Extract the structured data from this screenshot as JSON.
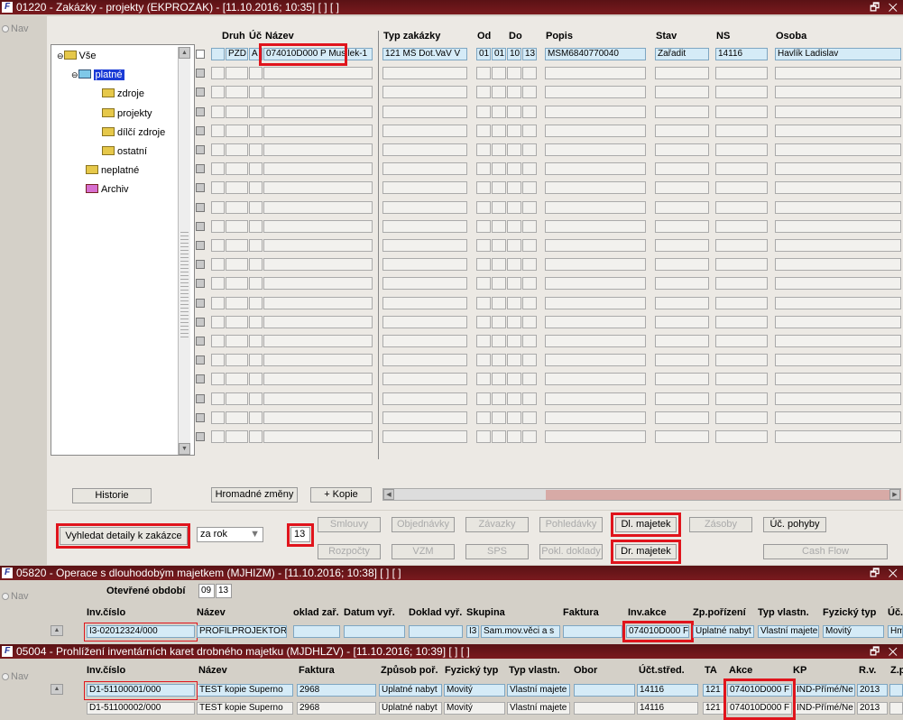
{
  "win1": {
    "title": "01220 - Zakázky - projekty (EKPROZAK) - [11.10.2016; 10:35]  [ ]  [ ]",
    "controls": "🗗 ✕"
  },
  "nav": "Nav",
  "tree": {
    "root": "Vše",
    "platne": "platné",
    "zdroje": "zdroje",
    "projekty": "projekty",
    "dilci": "dílčí zdroje",
    "ostatni": "ostatní",
    "neplatne": "neplatné",
    "archiv": "Archiv"
  },
  "grid": {
    "headers": {
      "druh": "Druh",
      "uc": "Úč",
      "nazev": "Název",
      "typ": "Typ zakázky",
      "od": "Od",
      "do": "Do",
      "popis": "Popis",
      "stav": "Stav",
      "ns": "NS",
      "osoba": "Osoba"
    },
    "row1": {
      "druh": "PZD",
      "uc": "A",
      "nazev": "074010D000 P Musilek-1",
      "typ": "121 MŠ Dot.VaV V",
      "od": "01",
      "do1": "01",
      "do2": "10",
      "do3": "13",
      "popis": "MSM6840770040",
      "stav": "Zařadit",
      "ns": "14116",
      "osoba": "Havlík Ladislav"
    }
  },
  "buttons": {
    "historie": "Historie",
    "hromadne": "Hromadné změny",
    "kopie": "+ Kopie",
    "vyhledat": "Vyhledat detaily k zakázce",
    "rok": "za rok",
    "rok_val": "13",
    "smlouvy": "Smlouvy",
    "objednavky": "Objednávky",
    "zavazky": "Závazky",
    "pohledavky": "Pohledávky",
    "dl_majetek": "Dl. majetek",
    "zasoby": "Zásoby",
    "uc_pohyby": "Úč. pohyby",
    "rozpocty": "Rozpočty",
    "vzm": "VZM",
    "sps": "SPS",
    "pokl": "Pokl. doklady",
    "dr_majetek": "Dr. majetek",
    "cashflow": "Cash Flow"
  },
  "win2": {
    "title": "05820 - Operace s dlouhodobým majetkem (MJHIZM) - [11.10.2016; 10:38]  [ ]  [ ]",
    "controls": "🗗 ✕",
    "obdobi_label": "Otevřené období",
    "obdobi_m": "09",
    "obdobi_y": "13",
    "headers": {
      "inv": "Inv.číslo",
      "nazev": "Název",
      "doklad": "oklad zař.",
      "datum": "Datum vyř.",
      "dokladvyr": "Doklad vyř.",
      "skupina": "Skupina",
      "faktura": "Faktura",
      "akce": "Inv.akce",
      "zp": "Zp.pořízení",
      "typ": "Typ vlastn.",
      "fyz": "Fyzický typ",
      "uc": "Úč."
    },
    "row": {
      "inv": "I3-02012324/000",
      "nazev": "PROFILPROJEKTOR",
      "sk1": "I3",
      "sk2": "Sam.mov.věci a s",
      "akce": "074010D000 F",
      "zp": "Úplatné nabyt",
      "typ": "Vlastní majete",
      "fyz": "Movitý",
      "uc": "Hm"
    }
  },
  "win3": {
    "title": "05004 - Prohlížení inventárních karet drobného majetku (MJDHLZV) - [11.10.2016; 10:39]  [ ]  [ ]",
    "controls": "🗗 ✕",
    "headers": {
      "inv": "Inv.číslo",
      "nazev": "Název",
      "faktura": "Faktura",
      "zp": "Způsob poř.",
      "fyz": "Fyzický typ",
      "typ": "Typ vlastn.",
      "obor": "Obor",
      "uc": "Účt.střed.",
      "ta": "TA",
      "akce": "Akce",
      "kp": "KP",
      "rv": "R.v.",
      "z": "Z.p"
    },
    "rows": [
      {
        "inv": "D1-51100001/000",
        "nazev": "TEST kopie Superno",
        "faktura": "2968",
        "zp": "Úplatné nabyt",
        "fyz": "Movitý",
        "typ": "Vlastní majete",
        "uc": "14116",
        "ta": "121",
        "akce": "074010D000 F",
        "kp": "IND-Přímé/Ne",
        "rv": "2013"
      },
      {
        "inv": "D1-51100002/000",
        "nazev": "TEST kopie Superno",
        "faktura": "2968",
        "zp": "Úplatné nabyt",
        "fyz": "Movitý",
        "typ": "Vlastní majete",
        "uc": "14116",
        "ta": "121",
        "akce": "074010D000 F",
        "kp": "IND-Přímé/Ne",
        "rv": "2013"
      }
    ]
  }
}
